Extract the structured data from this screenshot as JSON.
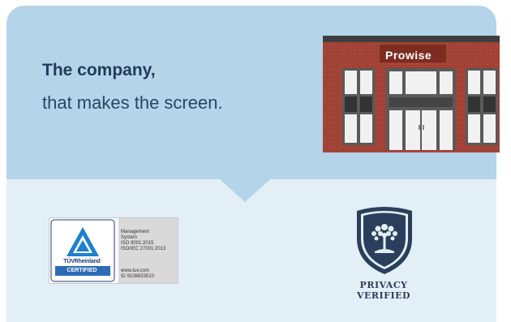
{
  "hero": {
    "headline": "The company,",
    "subline": "that makes the screen."
  },
  "building": {
    "brand_text": "Prowise"
  },
  "tuv_badge": {
    "brand": "TÜVRheinland",
    "certified": "CERTIFIED",
    "line1": "Management",
    "line2": "System",
    "line3": "ISO 9001:2015",
    "line4": "ISO/IEC 27001:2013",
    "url": "www.tuv.com",
    "id": "ID 9108653510"
  },
  "privacy_badge": {
    "line1": "PRIVACY",
    "line2": "VERIFIED"
  },
  "colors": {
    "top_panel": "#b4d4e9",
    "bottom_panel": "#e3eff7",
    "text_dark": "#233b5a",
    "brick": "#a8473a",
    "shield": "#2b3f5c"
  }
}
